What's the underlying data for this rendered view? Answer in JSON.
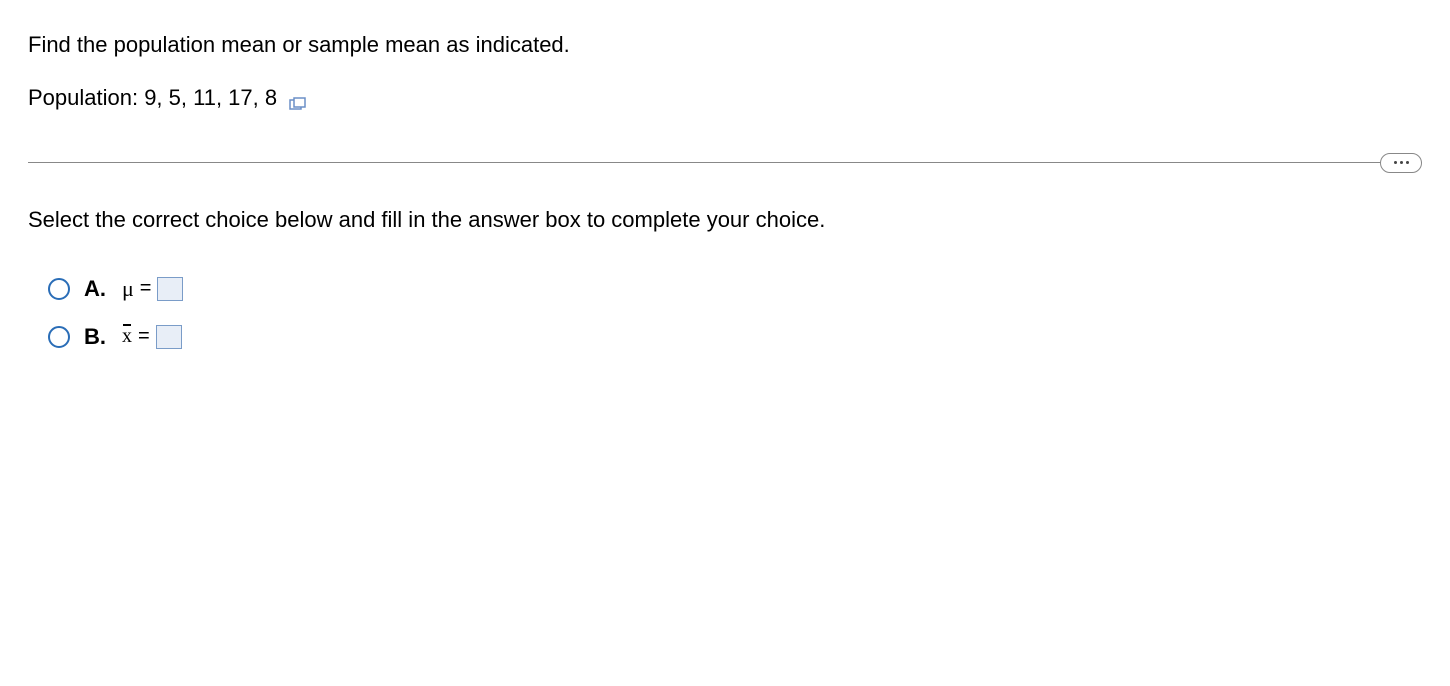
{
  "question": {
    "prompt": "Find the population mean or sample mean as indicated.",
    "data_line": "Population: 9, 5, 11, 17, 8"
  },
  "instruction": "Select the correct choice below and fill in the answer box to complete your choice.",
  "choices": {
    "a": {
      "letter": "A.",
      "symbol": "μ",
      "equals": "="
    },
    "b": {
      "letter": "B.",
      "symbol": "x",
      "equals": "="
    }
  }
}
